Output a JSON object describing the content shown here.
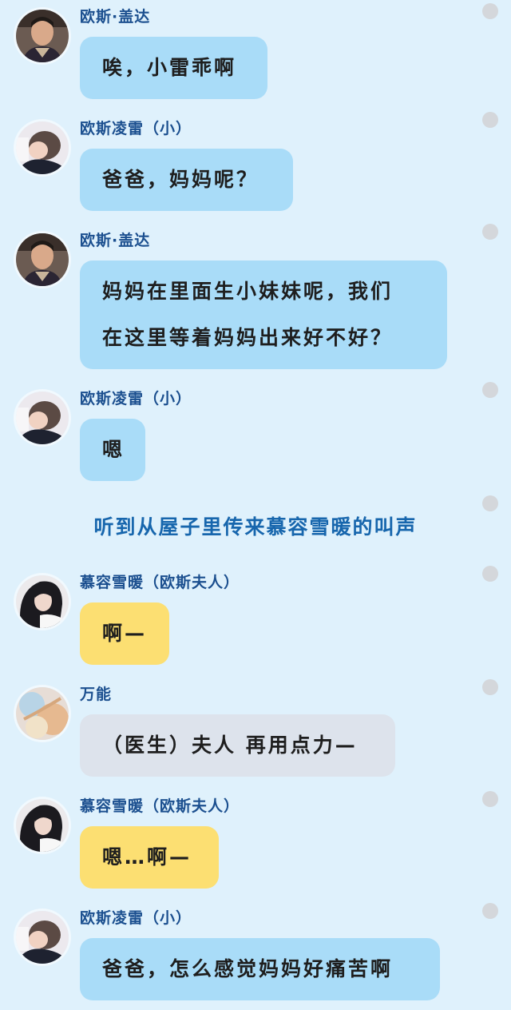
{
  "characters": {
    "father": {
      "name": "欧斯·盖达",
      "avatar": "man-portrait-avatar"
    },
    "son": {
      "name": "欧斯凌雷（小）",
      "avatar": "child-portrait-avatar"
    },
    "mother": {
      "name": "慕容雪暖（欧斯夫人）",
      "avatar": "dark-haired-woman-avatar"
    },
    "narrator": {
      "name": "万能",
      "avatar": "pastel-artwork-avatar"
    }
  },
  "messages": [
    {
      "speaker": "欧斯·盖达",
      "text": "唉，小雷乖啊",
      "bubble": "blue"
    },
    {
      "speaker": "欧斯凌雷（小）",
      "text": "爸爸，妈妈呢？",
      "bubble": "blue"
    },
    {
      "speaker": "欧斯·盖达",
      "lines": [
        "妈妈在里面生小妹妹呢，我们",
        "在这里等着妈妈出来好不好？"
      ],
      "bubble": "blue"
    },
    {
      "speaker": "欧斯凌雷（小）",
      "text": "嗯",
      "bubble": "blue"
    },
    {
      "narration": "听到从屋子里传来慕容雪暖的叫声"
    },
    {
      "speaker": "慕容雪暖（欧斯夫人）",
      "text": "啊—",
      "bubble": "yellow"
    },
    {
      "speaker": "万能",
      "text": "（医生）夫人 再用点力—",
      "bubble": "gray"
    },
    {
      "speaker": "慕容雪暖（欧斯夫人）",
      "text": "嗯…啊—",
      "bubble": "yellow"
    },
    {
      "speaker": "欧斯凌雷（小）",
      "text": "爸爸，怎么感觉妈妈好痛苦啊",
      "bubble": "blue"
    }
  ],
  "colors": {
    "background": "#dff1fc",
    "bubble_blue": "#a9dcf8",
    "bubble_yellow": "#fcdf72",
    "bubble_gray": "#dde3ec",
    "name_text": "#1b4f8f",
    "narration_text": "#1766ad",
    "status_dot": "#d4d7db"
  }
}
